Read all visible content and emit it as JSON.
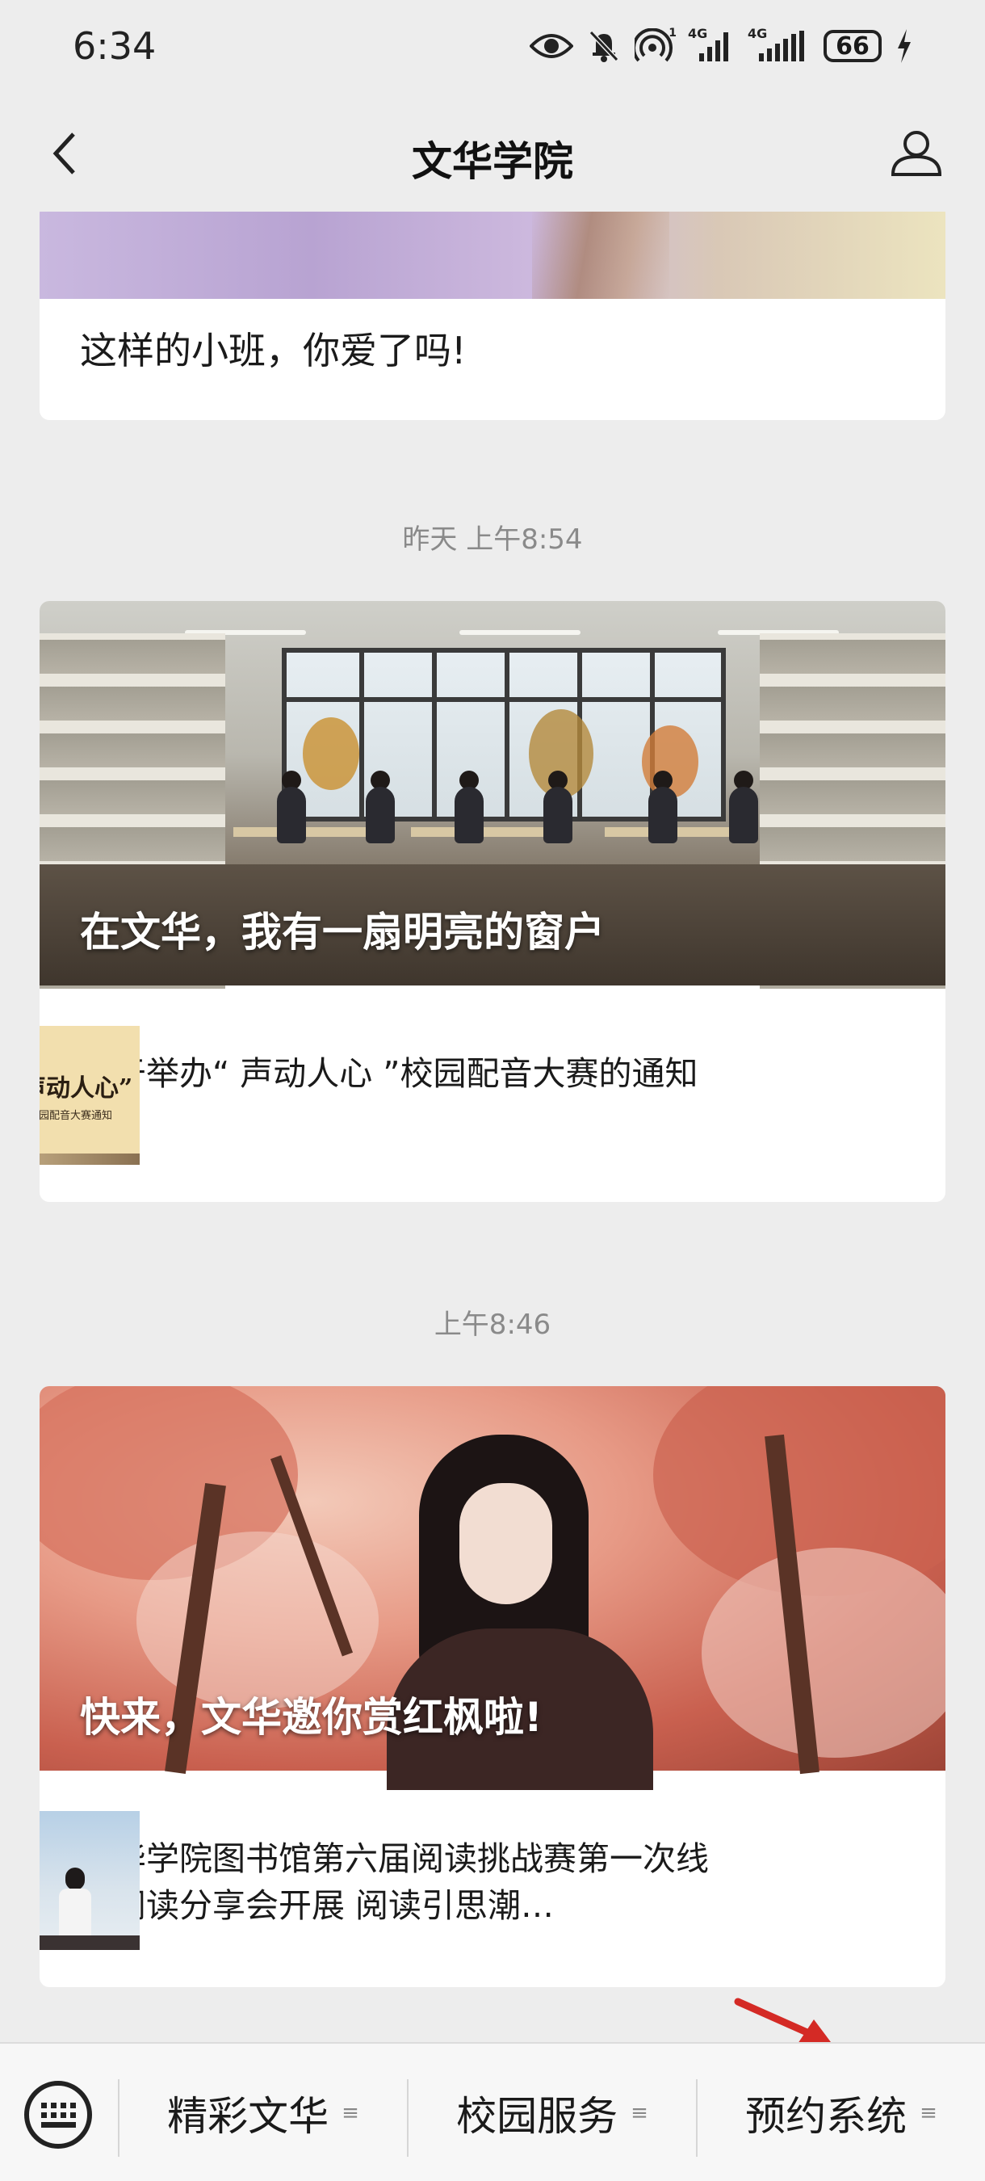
{
  "status_bar": {
    "time": "6:34",
    "battery": "66",
    "icons": [
      "eye-icon",
      "mute-icon",
      "hotspot-icon",
      "signal-4g-icon",
      "signal-4g-icon",
      "battery-icon",
      "charging-icon"
    ],
    "signal_labels": [
      "4G",
      "4G"
    ],
    "hotspot_badge": "1"
  },
  "header": {
    "title": "文华学院",
    "back_icon": "chevron-left-icon",
    "profile_icon": "person-icon"
  },
  "feed": {
    "partial_card": {
      "title": "这样的小班，你爱了吗!"
    },
    "groups": [
      {
        "timestamp": "昨天 上午8:54",
        "cover_title": "在文华，我有一扇明亮的窗户",
        "sub_title": "关于举办“ 声动人心 ”校园配音大赛的通知",
        "thumb": {
          "title": "“声动人心”",
          "subtitle": "校园配音大赛通知"
        }
      },
      {
        "timestamp": "上午8:46",
        "cover_title": "快来，文华邀你赏红枫啦!",
        "sub_title": "文华学院图书馆第六届阅读挑战赛第一次线下阅读分享会开展 阅读引思潮…"
      }
    ]
  },
  "bottom_menu": {
    "keyboard_icon": "keyboard-icon",
    "items": [
      {
        "label": "精彩文华",
        "icon": "≡"
      },
      {
        "label": "校园服务",
        "icon": "≡"
      },
      {
        "label": "预约系统",
        "icon": "≡"
      }
    ]
  },
  "colors": {
    "background": "#ededed",
    "card": "#ffffff",
    "annotation_arrow": "#d42a25"
  }
}
